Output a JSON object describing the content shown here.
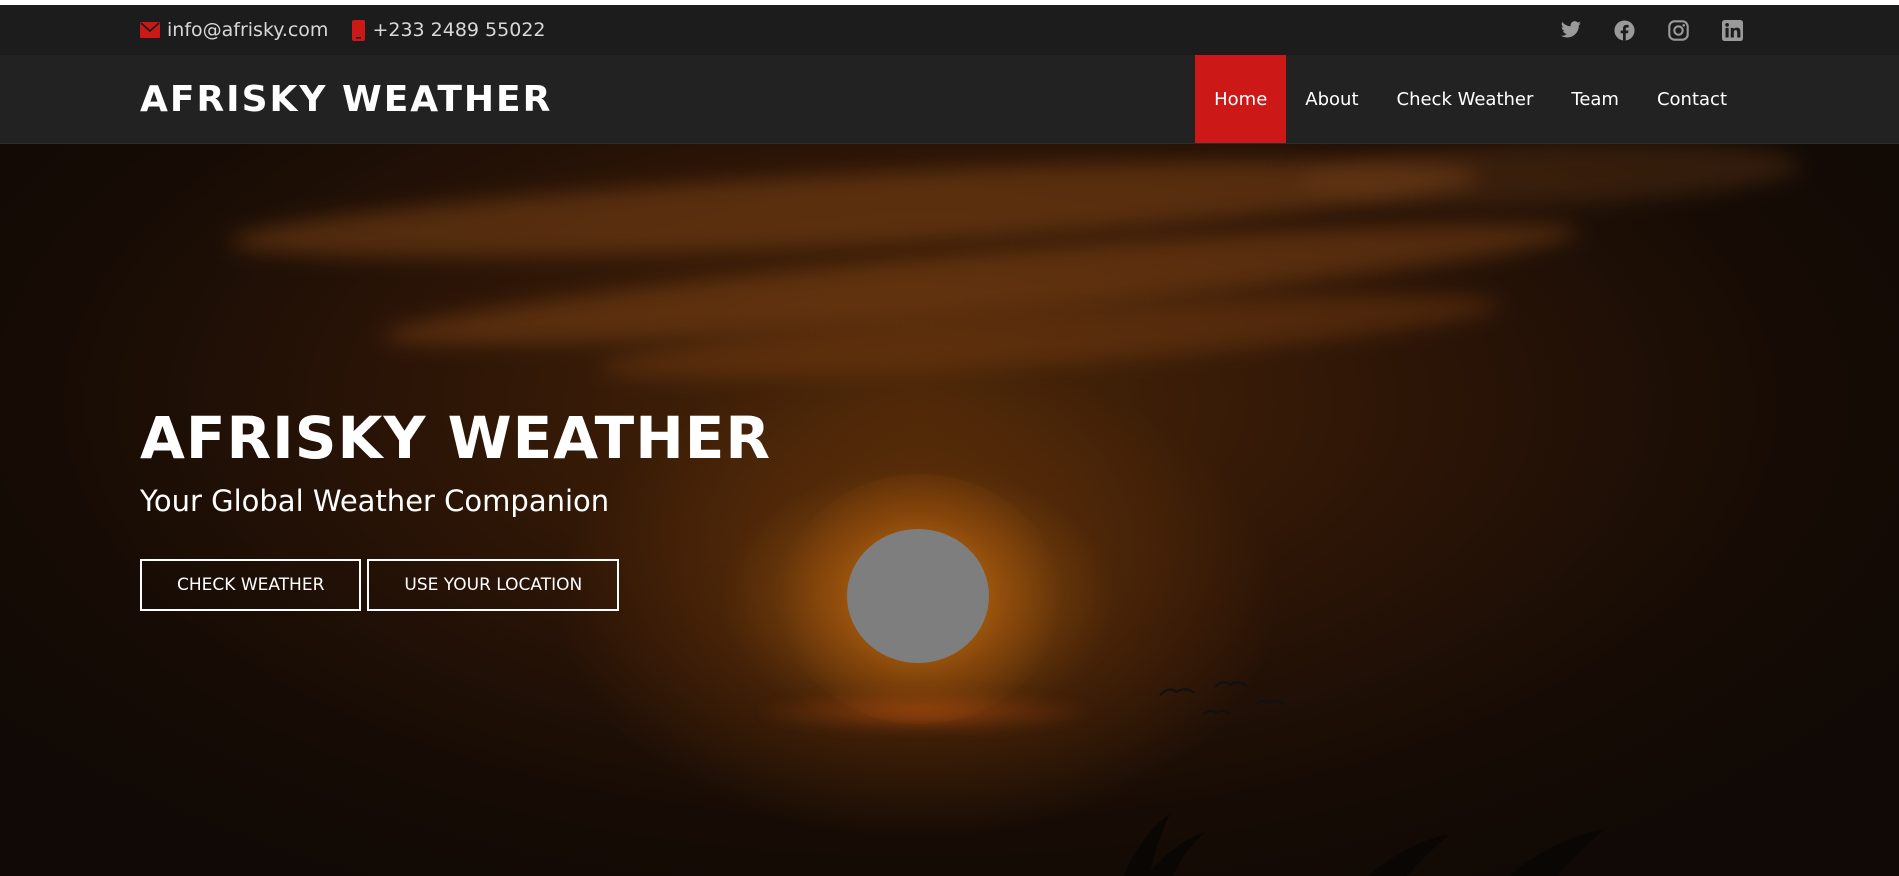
{
  "topbar": {
    "email": "info@afrisky.com",
    "phone": "+233 2489 55022",
    "contact_icons": [
      "envelope-icon",
      "phone-icon"
    ],
    "social": [
      {
        "icon": "twitter-icon"
      },
      {
        "icon": "facebook-icon"
      },
      {
        "icon": "instagram-icon"
      },
      {
        "icon": "linkedin-icon"
      }
    ]
  },
  "header": {
    "logo": "AFRISKY WEATHER",
    "nav": [
      {
        "label": "Home",
        "active": true
      },
      {
        "label": "About"
      },
      {
        "label": "Check Weather"
      },
      {
        "label": "Team"
      },
      {
        "label": "Contact"
      }
    ]
  },
  "hero": {
    "title": "AFRISKY WEATHER",
    "subtitle": "Your Global Weather Companion",
    "buttons": {
      "check_weather": "CHECK WEATHER",
      "use_location": "USE YOUR LOCATION"
    }
  },
  "colors": {
    "accent": "#cd1818",
    "topbar_bg": "#1c1c1c",
    "header_bg": "#222222",
    "text": "#ffffff"
  }
}
